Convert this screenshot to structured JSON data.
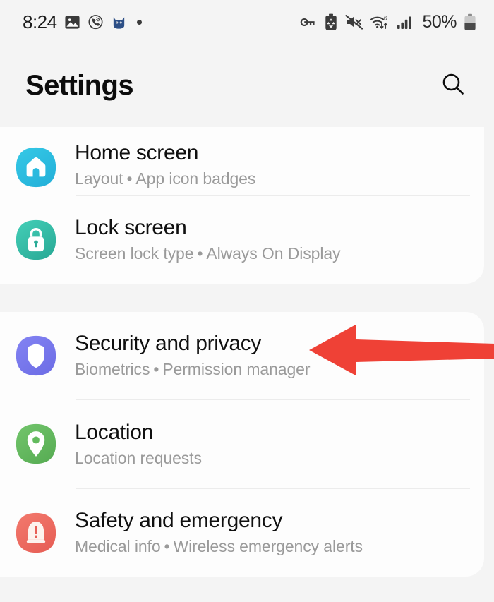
{
  "status_bar": {
    "time": "8:24",
    "battery_percent": "50%",
    "left_icons": [
      {
        "name": "gallery-icon",
        "label": "Gallery"
      },
      {
        "name": "viber-icon",
        "label": "Viber"
      },
      {
        "name": "cat-app-icon",
        "label": "Cat app"
      },
      {
        "name": "more-notifications-dot-icon",
        "label": "More notifications"
      }
    ],
    "right_icons": [
      {
        "name": "vpn-key-icon",
        "label": "VPN"
      },
      {
        "name": "battery-saver-icon",
        "label": "Battery saver"
      },
      {
        "name": "sound-muted-icon",
        "label": "Sound muted"
      },
      {
        "name": "wifi-6-icon",
        "label": "Wi-Fi 6"
      },
      {
        "name": "cellular-signal-icon",
        "label": "Cellular signal"
      },
      {
        "name": "battery-icon",
        "label": "Battery"
      }
    ]
  },
  "header": {
    "title": "Settings",
    "search_icon": "search-icon"
  },
  "groups": [
    {
      "id": "display-group",
      "items": [
        {
          "id": "home-screen",
          "title": "Home screen",
          "subtitle_parts": [
            "Layout",
            "App icon badges"
          ],
          "icon": "home-icon",
          "icon_color": "#2ec1e0",
          "icon_color_2": "#27b6dd",
          "partial": true
        },
        {
          "id": "lock-screen",
          "title": "Lock screen",
          "subtitle_parts": [
            "Screen lock type",
            "Always On Display"
          ],
          "icon": "lock-icon",
          "icon_color": "#3ec9b4",
          "icon_color_2": "#2fb39c",
          "partial": false
        }
      ]
    },
    {
      "id": "privacy-group",
      "items": [
        {
          "id": "security-and-privacy",
          "title": "Security and privacy",
          "subtitle_parts": [
            "Biometrics",
            "Permission manager"
          ],
          "icon": "shield-icon",
          "icon_color": "#7b7bee",
          "icon_color_2": "#6f6fe8",
          "partial": false
        },
        {
          "id": "location",
          "title": "Location",
          "subtitle_parts": [
            "Location requests"
          ],
          "icon": "location-pin-icon",
          "icon_color": "#68bd63",
          "icon_color_2": "#5cb257",
          "partial": false
        },
        {
          "id": "safety-and-emergency",
          "title": "Safety and emergency",
          "subtitle_parts": [
            "Medical info",
            "Wireless emergency alerts"
          ],
          "icon": "emergency-siren-icon",
          "icon_color": "#ee6f64",
          "icon_color_2": "#e9635a",
          "partial": false
        }
      ]
    }
  ],
  "annotation": {
    "type": "arrow",
    "name": "red-pointer-arrow",
    "color": "#ef4136",
    "points_to": "security-and-privacy"
  },
  "separator_symbol": "•"
}
